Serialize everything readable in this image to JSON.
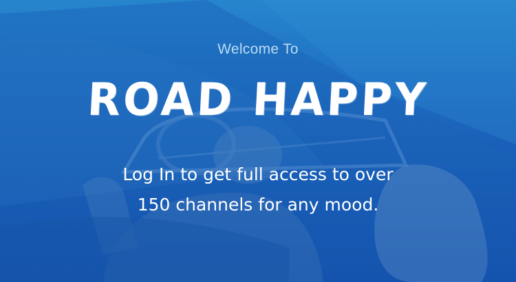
{
  "screen": {
    "welcome_text": "Welcome To",
    "brand_name": "ROAD HAPPY",
    "tagline_line1": "Log In to get full access to over",
    "tagline_line2": "150 channels for any mood."
  },
  "colors": {
    "background_top": "#2a8fcf",
    "background_bottom": "#124aa8",
    "welcome_text": "#b9dcf3",
    "brand_text": "#ffffff",
    "tagline_text": "#ffffff"
  },
  "background": {
    "image_description_icon": "convertible-car-couple-photo"
  }
}
